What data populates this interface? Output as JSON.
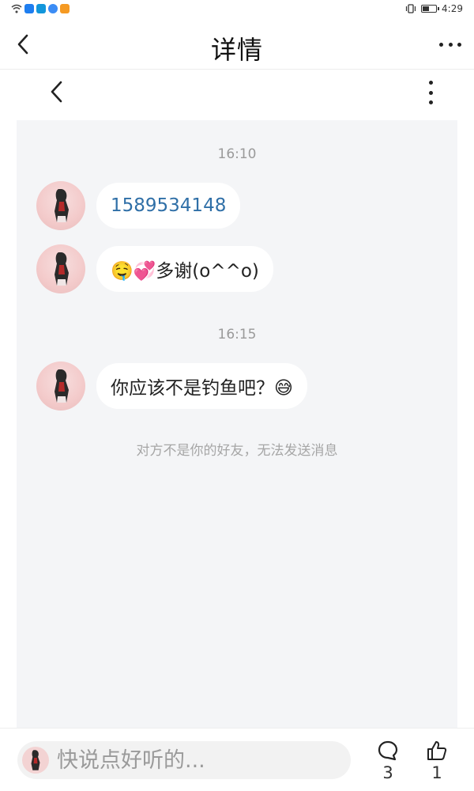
{
  "status_bar": {
    "time": "4:29",
    "app_icons": [
      "wifi-icon",
      "app-icon-1",
      "app-icon-2",
      "app-icon-3",
      "app-icon-4"
    ],
    "app_colors": [
      "#1e7ef0",
      "#1296db",
      "#3b8cf5",
      "#f59a23"
    ]
  },
  "nav": {
    "title": "详情",
    "back_icon": "chevron-left-icon",
    "more_icon": "more-horizontal-icon"
  },
  "inner_header": {
    "back_icon": "chevron-left-icon",
    "more_icon": "more-vertical-icon"
  },
  "chat": {
    "groups": [
      {
        "time": "16:10",
        "messages": [
          {
            "text": "1589534148",
            "type": "link"
          },
          {
            "text": "🤤💞多谢(o^^o)",
            "type": "text"
          }
        ]
      },
      {
        "time": "16:15",
        "messages": [
          {
            "text": "你应该不是钓鱼吧？😅",
            "type": "text"
          }
        ]
      }
    ],
    "notice": "对方不是你的好友，无法发送消息"
  },
  "bottom_bar": {
    "input_placeholder": "快说点好听的...",
    "comment_count": "3",
    "like_count": "1"
  },
  "colors": {
    "chat_background": "#f4f5f7",
    "bubble_background": "#ffffff",
    "link_color": "#2f6fa7",
    "muted_text": "#9a9a9a"
  }
}
